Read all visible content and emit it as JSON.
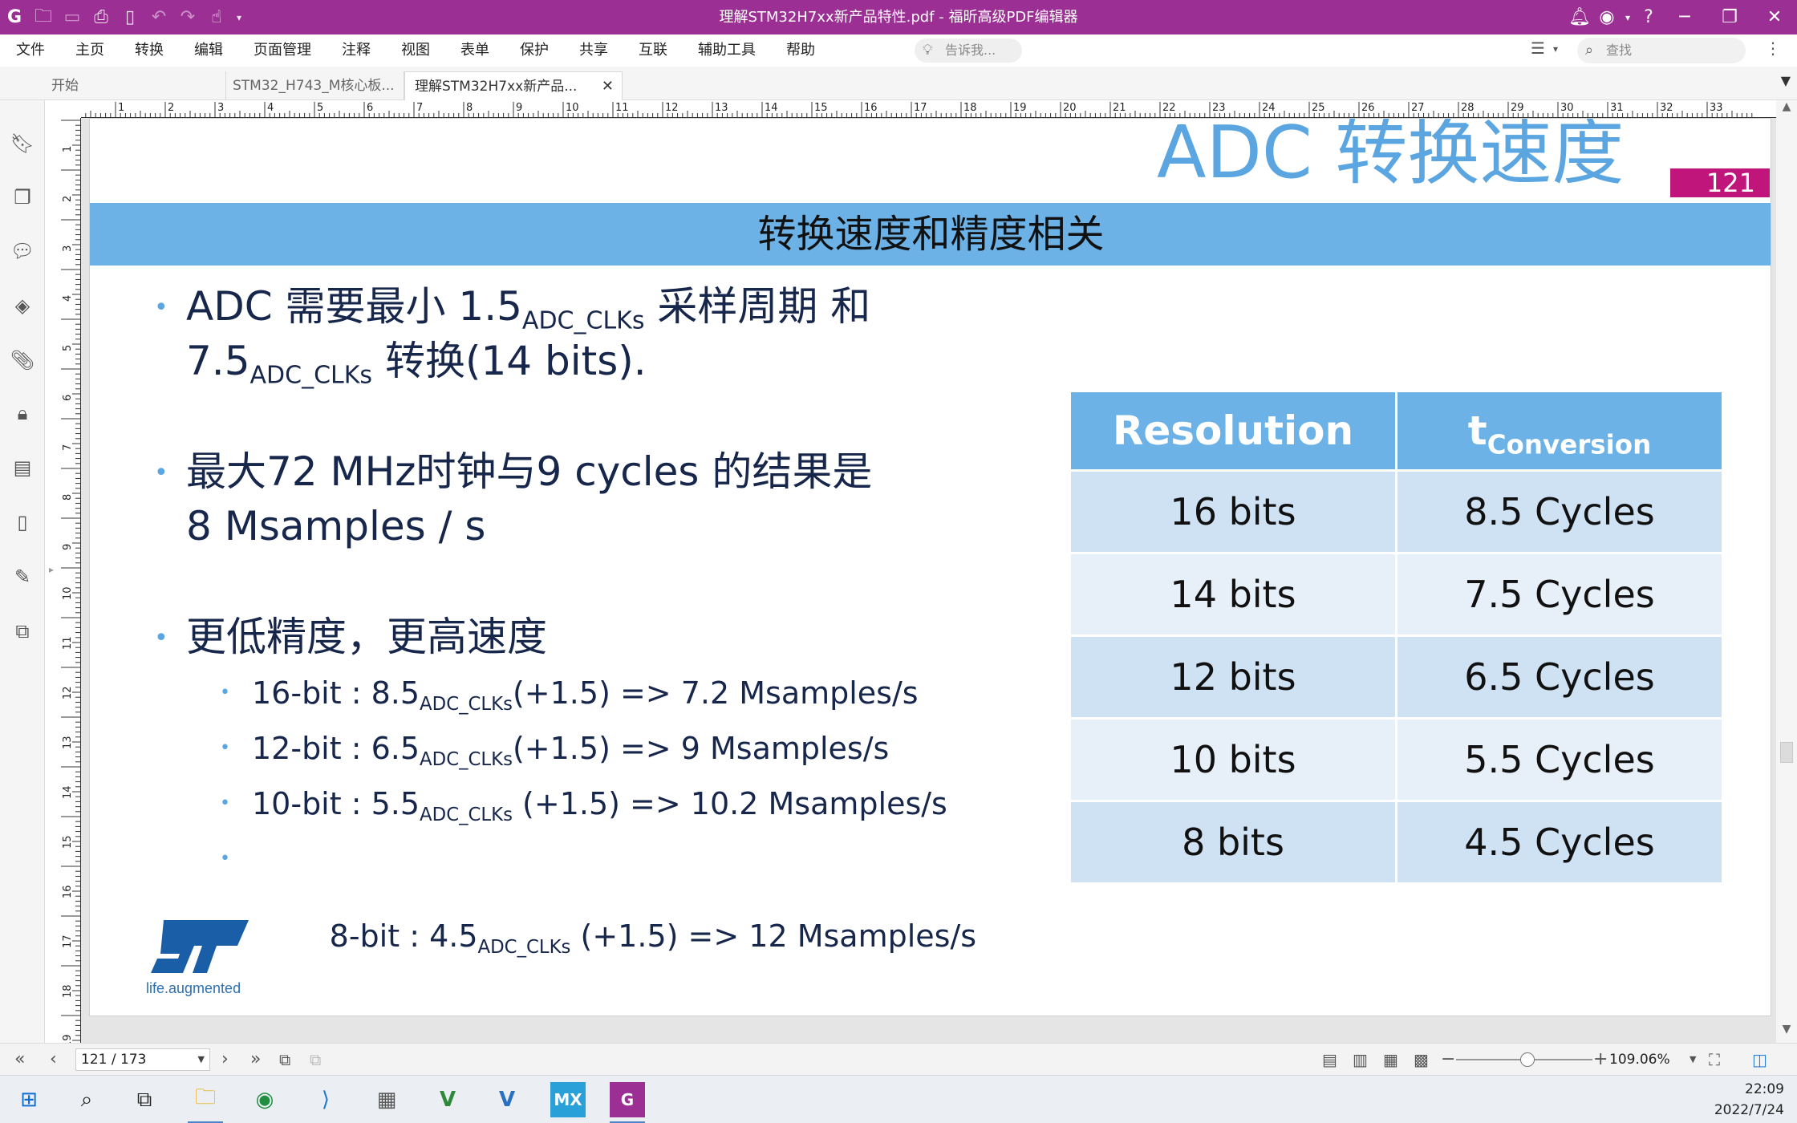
{
  "window": {
    "title": "理解STM32H7xx新产品特性.pdf - 福昕高级PDF编辑器",
    "accent_color": "#9b2f93"
  },
  "menu": {
    "items": [
      "文件",
      "主页",
      "转换",
      "编辑",
      "页面管理",
      "注释",
      "视图",
      "表单",
      "保护",
      "共享",
      "互联",
      "辅助工具",
      "帮助"
    ],
    "tellme_placeholder": "告诉我...",
    "search_placeholder": "查找"
  },
  "tabs": [
    {
      "label": "开始"
    },
    {
      "label": "STM32_H743_M核心板..."
    },
    {
      "label": "理解STM32H7xx新产品..."
    }
  ],
  "ruler": {
    "h_ticks": [
      "0",
      "1",
      "2",
      "3",
      "4",
      "5",
      "6",
      "7",
      "8",
      "9",
      "10",
      "11",
      "12",
      "13",
      "14",
      "15",
      "16",
      "17",
      "18",
      "19",
      "20",
      "21",
      "22",
      "23",
      "24",
      "25",
      "26",
      "27",
      "28",
      "29",
      "30",
      "31",
      "32",
      "33"
    ],
    "v_ticks": [
      "1",
      "2",
      "3",
      "4",
      "5",
      "6",
      "7",
      "8",
      "9",
      "10",
      "11",
      "12",
      "13",
      "14",
      "15",
      "16",
      "17",
      "18",
      "19"
    ]
  },
  "slide": {
    "title": "ADC 转换速度",
    "page_number": "121",
    "banner": "转换速度和精度相关",
    "bullet1": {
      "a": "ADC 需要最小 1.5",
      "a_sub": "ADC_CLKs",
      "b": " 采样周期 和",
      "c": "7.5",
      "c_sub": "ADC_CLKs",
      "d": " 转换(14 bits)."
    },
    "bullet2": {
      "line1": "最大72 MHz时钟与9 cycles 的结果是",
      "line2": "8 Msamples / s"
    },
    "bullet3": "更低精度，更高速度",
    "sub_bullets": [
      {
        "pre": "16-bit : 8.5",
        "sub": "ADC_CLKs",
        "post": "(+1.5) => 7.2 Msamples/s"
      },
      {
        "pre": "12-bit : 6.5",
        "sub": "ADC_CLKs",
        "post": "(+1.5) => 9 Msamples/s"
      },
      {
        "pre": "10-bit : 5.5",
        "sub": "ADC_CLKs",
        "post": " (+1.5) => 10.2 Msamples/s"
      },
      {
        "pre": "  8-bit : 4.5",
        "sub": "ADC_CLKs",
        "post": " (+1.5) => 12 Msamples/s"
      }
    ],
    "table": {
      "header_resolution": "Resolution",
      "header_t": "t",
      "header_t_sub": "Conversion",
      "rows": [
        {
          "resolution": "16 bits",
          "cycles": "8.5 Cycles"
        },
        {
          "resolution": "14 bits",
          "cycles": "7.5 Cycles"
        },
        {
          "resolution": "12 bits",
          "cycles": "6.5 Cycles"
        },
        {
          "resolution": "10 bits",
          "cycles": "5.5 Cycles"
        },
        {
          "resolution": "8 bits",
          "cycles": "4.5 Cycles"
        }
      ]
    },
    "logo_tagline": "life.augmented"
  },
  "status": {
    "page_indicator": "121 / 173",
    "zoom": "109.06%"
  },
  "taskbar": {
    "time": "22:09",
    "date": "2022/7/24"
  }
}
